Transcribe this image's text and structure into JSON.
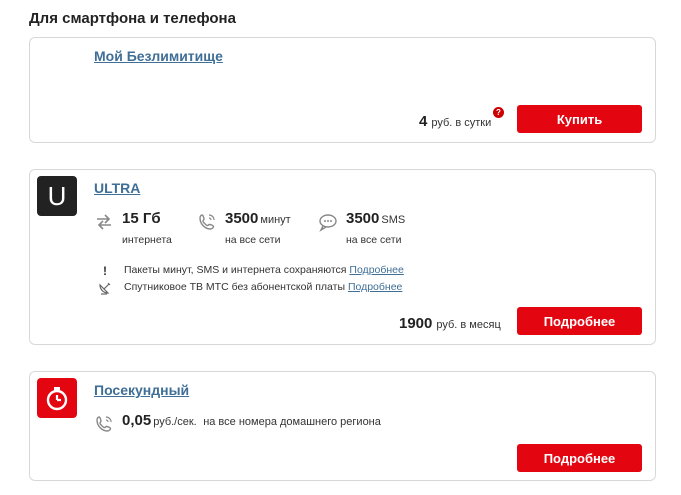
{
  "section_title": "Для смартфона и телефона",
  "cards": [
    {
      "name": "Мой Безлимитище",
      "price_amount": "4",
      "price_unit": "руб. в сутки",
      "help": "?",
      "button": "Купить"
    },
    {
      "name": "ULTRA",
      "logo_letter": "U",
      "features": [
        {
          "icon": "arrows-exchange-icon",
          "num": "15 Гб",
          "unit": "",
          "sub": "интернета"
        },
        {
          "icon": "phone-icon",
          "num": "3500",
          "unit": "минут",
          "sub": "на все сети"
        },
        {
          "icon": "chat-bubble-icon",
          "num": "3500",
          "unit": "SMS",
          "sub": "на все сети"
        }
      ],
      "notes": [
        {
          "icon": "exclamation-icon",
          "text": "Пакеты минут, SMS и интернета сохраняются",
          "link": "Подробнее"
        },
        {
          "icon": "satellite-dish-icon",
          "text": "Спутниковое ТВ МТС без абонентской платы",
          "link": "Подробнее"
        }
      ],
      "price_amount": "1900",
      "price_unit": "руб. в месяц",
      "button": "Подробнее"
    },
    {
      "name": "Посекундный",
      "logo_icon": "stopwatch-icon",
      "feature": {
        "icon": "phone-icon",
        "num": "0,05",
        "unit": "руб./сек.",
        "sub": "на все номера домашнего региона"
      },
      "button": "Подробнее"
    }
  ],
  "colors": {
    "accent": "#e30611",
    "link": "#3f6e96"
  }
}
